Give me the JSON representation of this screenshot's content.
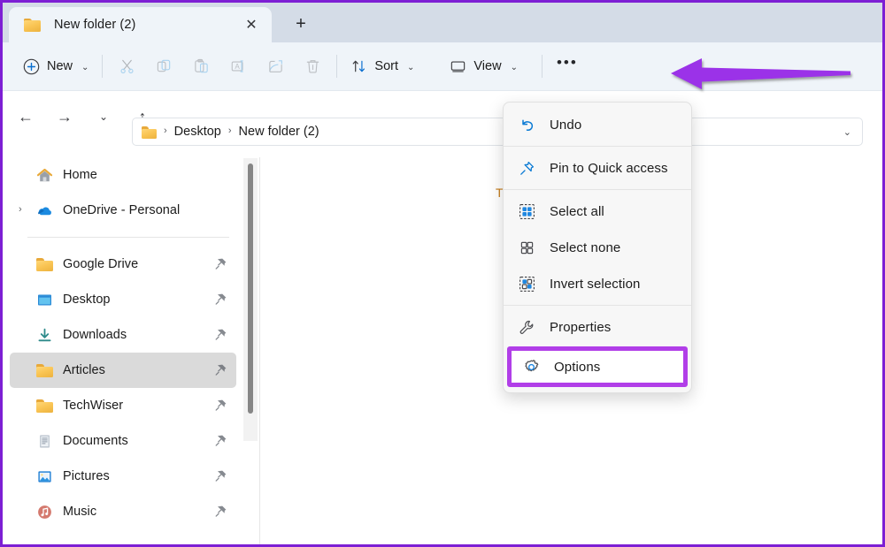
{
  "window": {
    "accent_highlight": "#b13ee8",
    "border_color": "#7d1fd4",
    "tabstrip_bg": "#d4dce7",
    "toolbar_bg": "#eff4f9"
  },
  "tabs": {
    "active": {
      "label": "New folder (2)",
      "icon": "folder-icon"
    },
    "close_label": "✕",
    "new_tab_label": "+"
  },
  "toolbar": {
    "new_label": "New",
    "new_icon": "plus-circle-icon",
    "cut_icon": "scissors-icon",
    "copy_icon": "copy-icon",
    "paste_icon": "paste-icon",
    "rename_icon": "rename-icon",
    "share_icon": "share-icon",
    "delete_icon": "trash-icon",
    "sort_label": "Sort",
    "sort_icon": "sort-arrows-icon",
    "view_label": "View",
    "view_icon": "monitor-icon",
    "more_label": "•••",
    "chevron": "⌄"
  },
  "navigation": {
    "back_icon": "←",
    "forward_icon": "→",
    "recent_icon": "⌄",
    "up_icon": "↑"
  },
  "address_bar": {
    "root_icon": "folder-icon",
    "separator": "›",
    "crumbs": [
      "Desktop",
      "New folder (2)"
    ],
    "dropdown_chevron": "⌄"
  },
  "sidebar": {
    "items": [
      {
        "label": "Home",
        "icon": "home-icon",
        "pinned": false,
        "expandable": false,
        "selected": false
      },
      {
        "label": "OneDrive - Personal",
        "icon": "onedrive-cloud-icon",
        "pinned": false,
        "expandable": true,
        "selected": false
      },
      {
        "separator": true
      },
      {
        "label": "Google Drive",
        "icon": "folder-icon",
        "pinned": true,
        "expandable": false,
        "selected": false
      },
      {
        "label": "Desktop",
        "icon": "desktop-icon",
        "pinned": true,
        "expandable": false,
        "selected": false
      },
      {
        "label": "Downloads",
        "icon": "download-icon",
        "pinned": true,
        "expandable": false,
        "selected": false
      },
      {
        "label": "Articles",
        "icon": "folder-icon",
        "pinned": true,
        "expandable": false,
        "selected": true
      },
      {
        "label": "TechWiser",
        "icon": "folder-icon",
        "pinned": true,
        "expandable": false,
        "selected": false
      },
      {
        "label": "Documents",
        "icon": "documents-icon",
        "pinned": true,
        "expandable": false,
        "selected": false
      },
      {
        "label": "Pictures",
        "icon": "pictures-icon",
        "pinned": true,
        "expandable": false,
        "selected": false
      },
      {
        "label": "Music",
        "icon": "music-icon",
        "pinned": true,
        "expandable": false,
        "selected": false
      }
    ],
    "expand_chevron": "›",
    "pin_icon": "pin-icon"
  },
  "content": {
    "empty_text": "Th"
  },
  "overflow_menu": {
    "items": [
      {
        "label": "Undo",
        "icon": "undo-icon"
      },
      {
        "separator": true
      },
      {
        "label": "Pin to Quick access",
        "icon": "pin-outline-icon"
      },
      {
        "separator": true
      },
      {
        "label": "Select all",
        "icon": "select-all-icon"
      },
      {
        "label": "Select none",
        "icon": "select-none-icon"
      },
      {
        "label": "Invert selection",
        "icon": "invert-selection-icon"
      },
      {
        "separator": true
      },
      {
        "label": "Properties",
        "icon": "wrench-icon"
      }
    ],
    "highlighted_item": {
      "label": "Options",
      "icon": "gear-icon"
    }
  },
  "annotation": {
    "arrow_color": "#9b30e8",
    "arrow_points_to": "more-options-button"
  }
}
